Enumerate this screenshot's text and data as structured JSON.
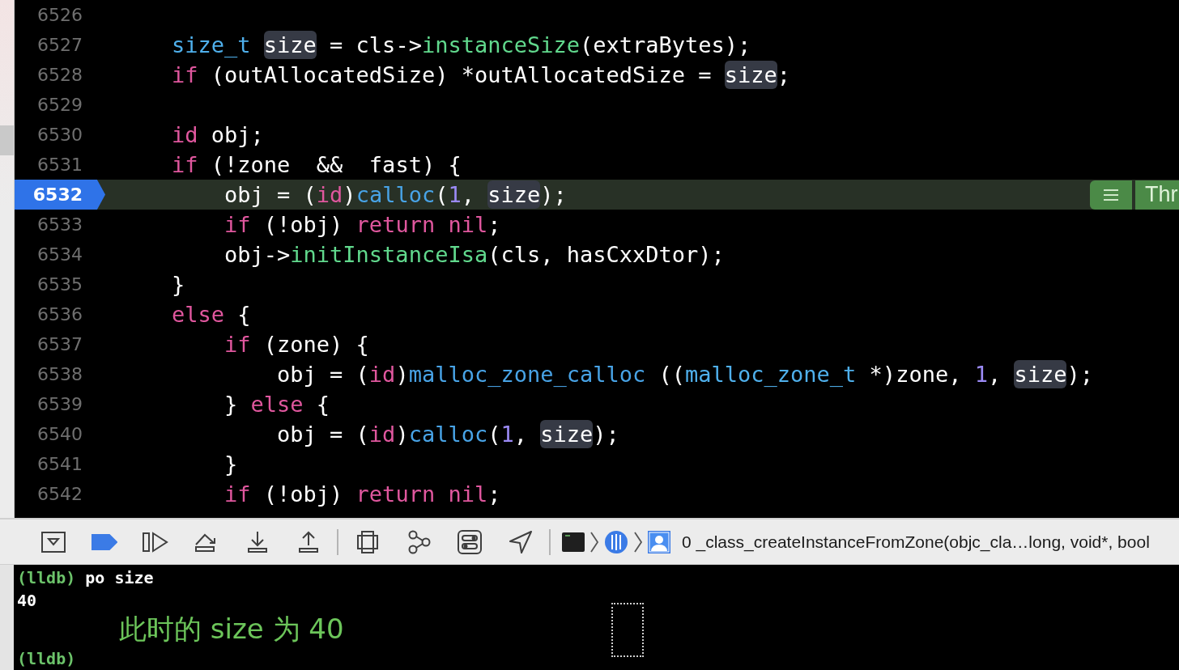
{
  "editor": {
    "lines": [
      {
        "number": "6526",
        "current": false
      },
      {
        "number": "6527",
        "current": false,
        "tokens": [
          {
            "kind": "type",
            "text": "    size_t "
          },
          {
            "kind": "match",
            "text": "size"
          },
          {
            "kind": "plain",
            "text": " = cls->"
          },
          {
            "kind": "method",
            "text": "instanceSize"
          },
          {
            "kind": "plain",
            "text": "(extraBytes);"
          }
        ]
      },
      {
        "number": "6528",
        "current": false,
        "tokens": [
          {
            "kind": "keyword",
            "text": "    if"
          },
          {
            "kind": "plain",
            "text": " (outAllocatedSize) *outAllocatedSize = "
          },
          {
            "kind": "match",
            "text": "size"
          },
          {
            "kind": "plain",
            "text": ";"
          }
        ]
      },
      {
        "number": "6529",
        "current": false
      },
      {
        "number": "6530",
        "current": false,
        "tokens": [
          {
            "kind": "keyword",
            "text": "    id"
          },
          {
            "kind": "plain",
            "text": " obj;"
          }
        ]
      },
      {
        "number": "6531",
        "current": false,
        "tokens": [
          {
            "kind": "keyword",
            "text": "    if"
          },
          {
            "kind": "plain",
            "text": " (!zone  &&  fast) {"
          }
        ]
      },
      {
        "number": "6532",
        "current": true,
        "tokens": [
          {
            "kind": "plain",
            "text": "        obj = ("
          },
          {
            "kind": "keyword",
            "text": "id"
          },
          {
            "kind": "plain",
            "text": ")"
          },
          {
            "kind": "function",
            "text": "calloc"
          },
          {
            "kind": "plain",
            "text": "("
          },
          {
            "kind": "number",
            "text": "1"
          },
          {
            "kind": "plain",
            "text": ", "
          },
          {
            "kind": "match",
            "text": "size"
          },
          {
            "kind": "plain",
            "text": ");"
          }
        ]
      },
      {
        "number": "6533",
        "current": false,
        "tokens": [
          {
            "kind": "keyword",
            "text": "        if"
          },
          {
            "kind": "plain",
            "text": " (!obj) "
          },
          {
            "kind": "keyword",
            "text": "return nil"
          },
          {
            "kind": "plain",
            "text": ";"
          }
        ]
      },
      {
        "number": "6534",
        "current": false,
        "tokens": [
          {
            "kind": "plain",
            "text": "        obj->"
          },
          {
            "kind": "method",
            "text": "initInstanceIsa"
          },
          {
            "kind": "plain",
            "text": "(cls, hasCxxDtor);"
          }
        ]
      },
      {
        "number": "6535",
        "current": false,
        "tokens": [
          {
            "kind": "plain",
            "text": "    }"
          }
        ]
      },
      {
        "number": "6536",
        "current": false,
        "tokens": [
          {
            "kind": "keyword",
            "text": "    else"
          },
          {
            "kind": "plain",
            "text": " {"
          }
        ]
      },
      {
        "number": "6537",
        "current": false,
        "tokens": [
          {
            "kind": "keyword",
            "text": "        if"
          },
          {
            "kind": "plain",
            "text": " (zone) {"
          }
        ]
      },
      {
        "number": "6538",
        "current": false,
        "tokens": [
          {
            "kind": "plain",
            "text": "            obj = ("
          },
          {
            "kind": "keyword",
            "text": "id"
          },
          {
            "kind": "plain",
            "text": ")"
          },
          {
            "kind": "function",
            "text": "malloc_zone_calloc"
          },
          {
            "kind": "plain",
            "text": " (("
          },
          {
            "kind": "type",
            "text": "malloc_zone_t"
          },
          {
            "kind": "plain",
            "text": " *)zone, "
          },
          {
            "kind": "number",
            "text": "1"
          },
          {
            "kind": "plain",
            "text": ", "
          },
          {
            "kind": "match",
            "text": "size"
          },
          {
            "kind": "plain",
            "text": ");"
          }
        ]
      },
      {
        "number": "6539",
        "current": false,
        "tokens": [
          {
            "kind": "plain",
            "text": "        } "
          },
          {
            "kind": "keyword",
            "text": "else"
          },
          {
            "kind": "plain",
            "text": " {"
          }
        ]
      },
      {
        "number": "6540",
        "current": false,
        "tokens": [
          {
            "kind": "plain",
            "text": "            obj = ("
          },
          {
            "kind": "keyword",
            "text": "id"
          },
          {
            "kind": "plain",
            "text": ")"
          },
          {
            "kind": "function",
            "text": "calloc"
          },
          {
            "kind": "plain",
            "text": "("
          },
          {
            "kind": "number",
            "text": "1"
          },
          {
            "kind": "plain",
            "text": ", "
          },
          {
            "kind": "match",
            "text": "size"
          },
          {
            "kind": "plain",
            "text": ");"
          }
        ]
      },
      {
        "number": "6541",
        "current": false,
        "tokens": [
          {
            "kind": "plain",
            "text": "        }"
          }
        ]
      },
      {
        "number": "6542",
        "current": false,
        "tokens": [
          {
            "kind": "keyword",
            "text": "        if"
          },
          {
            "kind": "plain",
            "text": " (!obj) "
          },
          {
            "kind": "keyword",
            "text": "return nil"
          },
          {
            "kind": "plain",
            "text": ";"
          }
        ]
      }
    ],
    "thread_badge": {
      "label": "Thr"
    }
  },
  "debug_bar": {
    "breakpoints_active": true,
    "frame": "0 _class_createInstanceFromZone(objc_cla…long, void*, bool"
  },
  "console": {
    "lines": [
      {
        "kind": "command",
        "prompt": "(lldb)",
        "text": "po size"
      },
      {
        "kind": "output",
        "text": "40"
      },
      {
        "kind": "prompt",
        "prompt": "(lldb)"
      }
    ],
    "annotation": "此时的 size 为 40"
  }
}
